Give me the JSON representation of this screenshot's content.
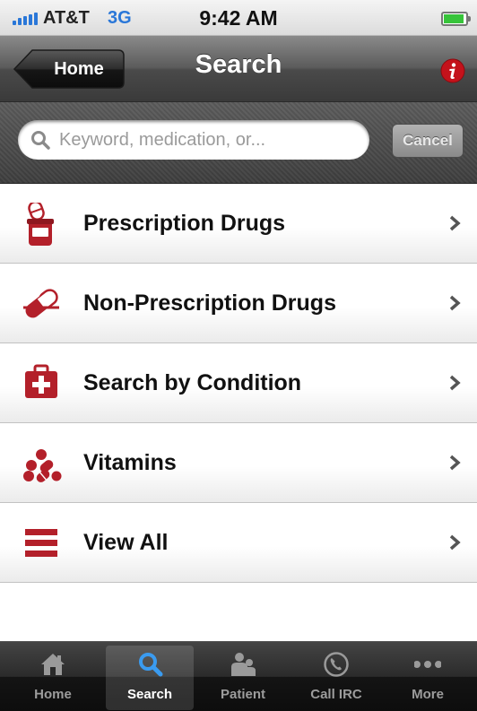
{
  "status_bar": {
    "carrier": "AT&T",
    "network": "3G",
    "time": "9:42 AM",
    "battery_level": 0.85
  },
  "nav": {
    "back_label": "Home",
    "title": "Search",
    "info_icon": "info-icon"
  },
  "search": {
    "placeholder": "Keyword, medication, or...",
    "value": "",
    "cancel_label": "Cancel"
  },
  "menu": {
    "items": [
      {
        "label": "Prescription Drugs",
        "icon": "pill-bottle-icon"
      },
      {
        "label": "Non-Prescription Drugs",
        "icon": "capsule-icon"
      },
      {
        "label": "Search by Condition",
        "icon": "first-aid-kit-icon"
      },
      {
        "label": "Vitamins",
        "icon": "vitamins-icon"
      },
      {
        "label": "View All",
        "icon": "list-icon"
      }
    ],
    "chevron_icon": "chevron-right-icon"
  },
  "tabbar": {
    "tabs": [
      {
        "label": "Home",
        "icon": "house-icon",
        "active": false
      },
      {
        "label": "Search",
        "icon": "search-icon",
        "active": true
      },
      {
        "label": "Patient",
        "icon": "people-icon",
        "active": false
      },
      {
        "label": "Call IRC",
        "icon": "phone-icon",
        "active": false
      },
      {
        "label": "More",
        "icon": "more-dots-icon",
        "active": false
      }
    ]
  },
  "colors": {
    "accent_red": "#b3202a",
    "signal_blue": "#2a77d8",
    "battery_green": "#37c43a",
    "active_tab_icon": "#3a9bf0"
  }
}
